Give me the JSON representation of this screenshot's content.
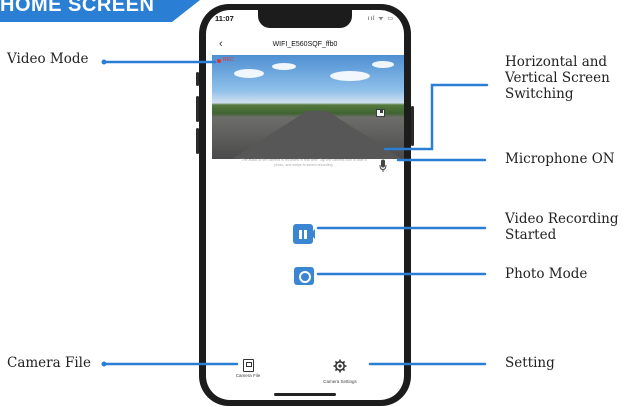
{
  "banner": {
    "text": "HOME SCREEN",
    "color": "#2a7fd4"
  },
  "callouts": {
    "video_mode": "Video Mode",
    "screen_switch": [
      "Horizontal and",
      "Vertical Screen",
      "Switching"
    ],
    "microphone": "Microphone ON",
    "video_recording": [
      "Video Recording",
      "Started"
    ],
    "photo_mode": "Photo Mode",
    "camera_file": "Camera File",
    "setting": "Setting",
    "line_color": "#2a7fd4"
  },
  "phone": {
    "status": {
      "time": "11:07",
      "icons": "ııl ᯤ ▭"
    },
    "header": {
      "back_icon": "chevron-left-icon",
      "title": "WIFI_E560SQF_ffb0"
    },
    "video": {
      "rec_label": "REC"
    },
    "notice": "The audio of the camera is recorded in real time. Tap the camera icon to take a photo, and swipe to switch recording.",
    "bottom_nav": [
      {
        "icon": "camera-file-icon",
        "label": "Camera File"
      },
      {
        "icon": "gear-icon",
        "label": "Camera Settings"
      }
    ],
    "button_color": "#3a86d3"
  }
}
